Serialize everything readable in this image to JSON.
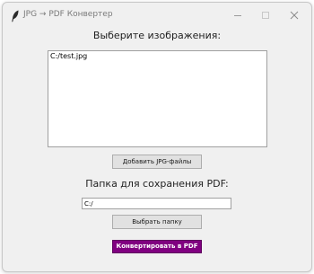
{
  "window": {
    "title": "JPG → PDF Конвертер"
  },
  "images_section": {
    "heading": "Выберите изображения:",
    "files": [
      "C:/test.jpg"
    ],
    "add_button_label": "Добавить JPG-файлы"
  },
  "folder_section": {
    "heading": "Папка для сохранения PDF:",
    "path_value": "C:/",
    "choose_button_label": "Выбрать папку"
  },
  "convert_button": {
    "label": "Конвертировать в PDF",
    "color": "#800080"
  },
  "icons": {
    "app": "feather-icon",
    "minimize": "minimize-icon",
    "maximize": "maximize-icon",
    "close": "close-icon"
  }
}
